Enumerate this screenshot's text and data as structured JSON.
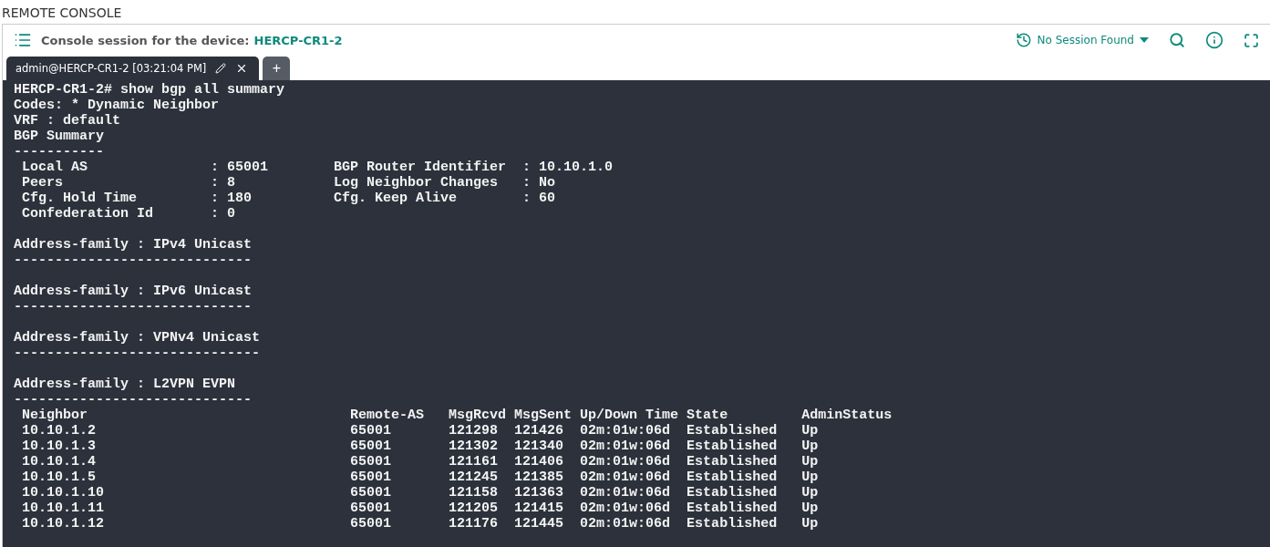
{
  "page_title": "REMOTE CONSOLE",
  "header": {
    "label": "Console session for the device:",
    "device": "HERCP-CR1-2",
    "session_menu": "No Session Found"
  },
  "tabs": [
    {
      "label": "admin@HERCP-CR1-2 [03:21:04 PM]",
      "selected": true
    }
  ],
  "new_tab_label": "+",
  "terminal": {
    "blocks": [
      [
        "HERCP-CR1-2# show bgp all summary",
        "Codes: * Dynamic Neighbor",
        "VRF : default",
        "BGP Summary",
        "-----------",
        " Local AS               : 65001        BGP Router Identifier  : 10.10.1.0",
        " Peers                  : 8            Log Neighbor Changes   : No",
        " Cfg. Hold Time         : 180          Cfg. Keep Alive        : 60",
        " Confederation Id       : 0"
      ],
      [
        "Address-family : IPv4 Unicast",
        "-----------------------------"
      ],
      [
        "Address-family : IPv6 Unicast",
        "-----------------------------"
      ],
      [
        "Address-family : VPNv4 Unicast",
        "------------------------------"
      ],
      [
        "Address-family : L2VPN EVPN",
        "-----------------------------",
        " Neighbor                                Remote-AS   MsgRcvd MsgSent Up/Down Time State         AdminStatus",
        " 10.10.1.2                               65001       121298  121426  02m:01w:06d  Established   Up",
        " 10.10.1.3                               65001       121302  121340  02m:01w:06d  Established   Up",
        " 10.10.1.4                               65001       121161  121406  02m:01w:06d  Established   Up",
        " 10.10.1.5                               65001       121245  121385  02m:01w:06d  Established   Up",
        " 10.10.1.10                              65001       121158  121363  02m:01w:06d  Established   Up",
        " 10.10.1.11                              65001       121205  121415  02m:01w:06d  Established   Up",
        " 10.10.1.12                              65001       121176  121445  02m:01w:06d  Established   Up"
      ]
    ]
  }
}
